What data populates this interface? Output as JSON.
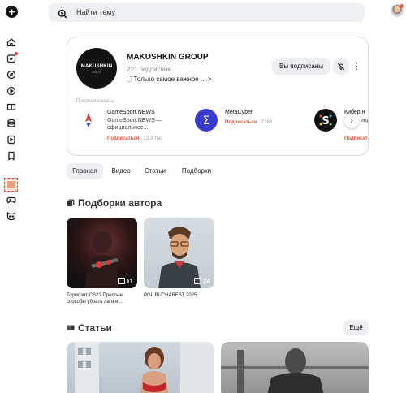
{
  "search": {
    "placeholder": "Найти тему"
  },
  "rail": {
    "icons": [
      "home-icon",
      "subscriptions-icon",
      "explore-icon",
      "video-icon",
      "articles-icon",
      "database-icon",
      "shorts-icon",
      "bookmark-icon",
      "promo-icon",
      "gamepad-icon",
      "mask-icon"
    ]
  },
  "channel": {
    "logo_text": "MAKUSHKIN",
    "logo_subtext": "GROUP",
    "name": "MAKUSHKIN GROUP",
    "subscribers": "221 подписчик",
    "description": "🗋 Только самое важное ... >",
    "subscribed_label": "Вы подписаны",
    "similar_label": "Похожие каналы",
    "similar": [
      {
        "name": "GameSport.NEWS",
        "desc": "GameSport.NEWS — официальное...",
        "subscribe": "Подписаться",
        "count": "· 12,3 тыс",
        "color": "#ffffff",
        "icon": "rocket-icon"
      },
      {
        "name": "MetaCyber",
        "desc": "",
        "subscribe": "Подписаться",
        "count": "· 7168",
        "color": "#3a3ad0",
        "icon": "sigma-icon"
      },
      {
        "name": "Кибер н",
        "desc": "Всё о индустр",
        "subscribe": "Подписат",
        "count": "",
        "color": "#111111",
        "icon": "s-logo-icon"
      }
    ]
  },
  "tabs": [
    "Главная",
    "Видео",
    "Статьи",
    "Подборки"
  ],
  "collections": {
    "title": "Подборки автора",
    "items": [
      {
        "caption": "Тормозит CS2? Простые способы убрать лаги и...",
        "count": "11"
      },
      {
        "caption": "PGL BUCHAREST 2025",
        "count": "24"
      }
    ]
  },
  "articles": {
    "title": "Статьи",
    "more_label": "Ещё"
  }
}
